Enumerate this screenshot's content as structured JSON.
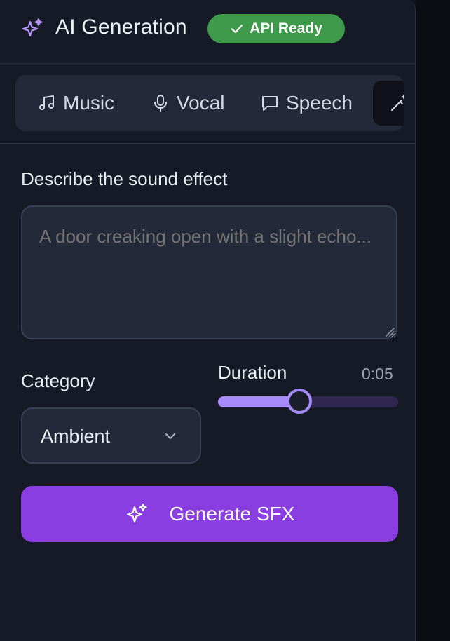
{
  "header": {
    "title": "AI Generation",
    "icon": "sparkles-icon",
    "badge_label": "API Ready",
    "badge_color": "#3e9a4a"
  },
  "tabs": [
    {
      "label": "Music",
      "icon": "music-note-icon"
    },
    {
      "label": "Vocal",
      "icon": "microphone-icon"
    },
    {
      "label": "Speech",
      "icon": "speech-bubble-icon"
    },
    {
      "label": "",
      "icon": "magic-wand-icon",
      "active": true
    }
  ],
  "sfx": {
    "prompt_label": "Describe the sound effect",
    "prompt_placeholder": "A door creaking open with a slight echo...",
    "category_label": "Category",
    "category_value": "Ambient",
    "duration_label": "Duration",
    "duration_value": "0:05",
    "duration_fraction": 0.45,
    "generate_label": "Generate SFX"
  },
  "colors": {
    "accent": "#8a3de0",
    "slider": "#a78bfa",
    "background": "#151a26"
  }
}
